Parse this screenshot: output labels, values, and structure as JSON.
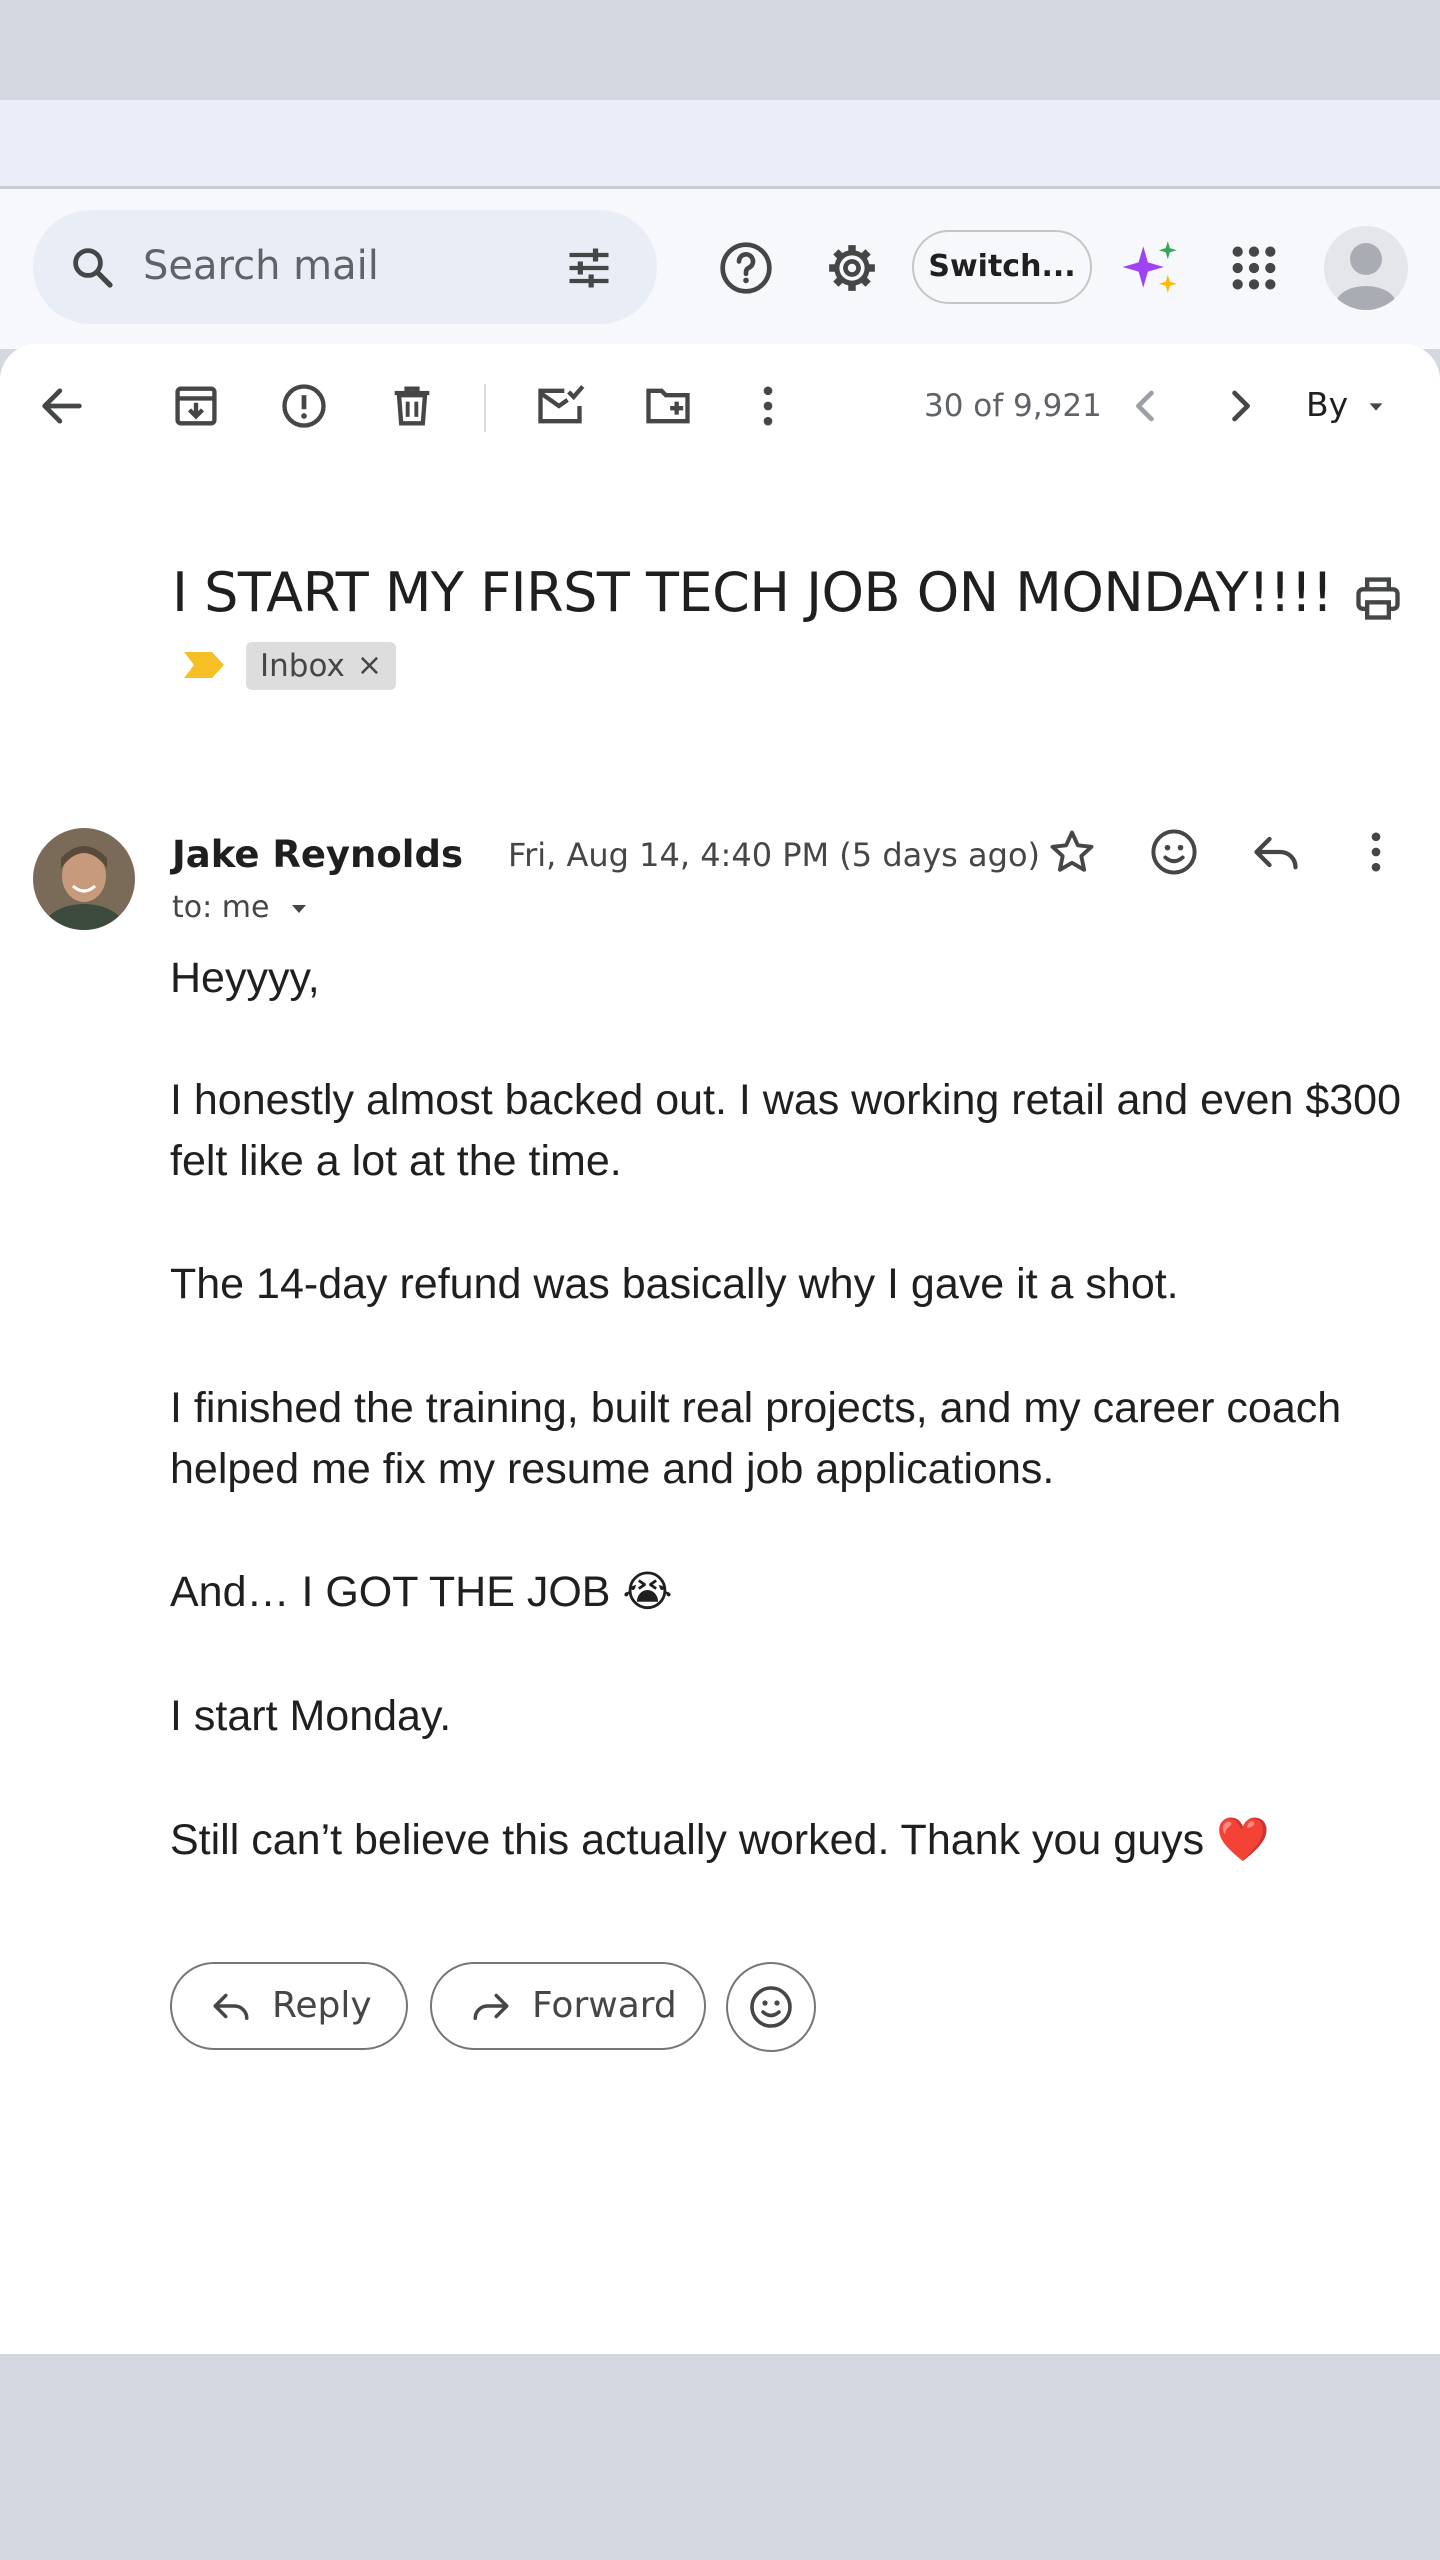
{
  "search": {
    "placeholder": "Search mail"
  },
  "header": {
    "switch_label": "Switch..."
  },
  "toolbar": {
    "page_count": "30 of 9,921",
    "sort_label": "By"
  },
  "email": {
    "subject": "I START MY FIRST TECH JOB ON MONDAY!!!!",
    "label": "Inbox",
    "label_close": "×",
    "sender_name": "Jake Reynolds",
    "date": "Fri, Aug 14, 4:40 PM (5 days ago)",
    "to": "to: me",
    "body": [
      "Heyyyy,",
      "I honestly almost backed out. I was working retail and even $300 felt like a lot at the time.",
      "The 14-day refund was basically why I gave it a shot.",
      "I finished the training, built real projects, and my career coach helped me fix my resume and job applications.",
      "And… I GOT THE JOB 😭",
      "I start Monday.",
      "Still can’t believe this actually worked. Thank you guys ❤️"
    ]
  },
  "actions": {
    "reply_label": "Reply",
    "forward_label": "Forward"
  },
  "colors": {
    "accent": "#1a73e8",
    "label_marker": "#f6bf26",
    "panel": "#ffffff",
    "chrome": "#f6f8fc"
  }
}
